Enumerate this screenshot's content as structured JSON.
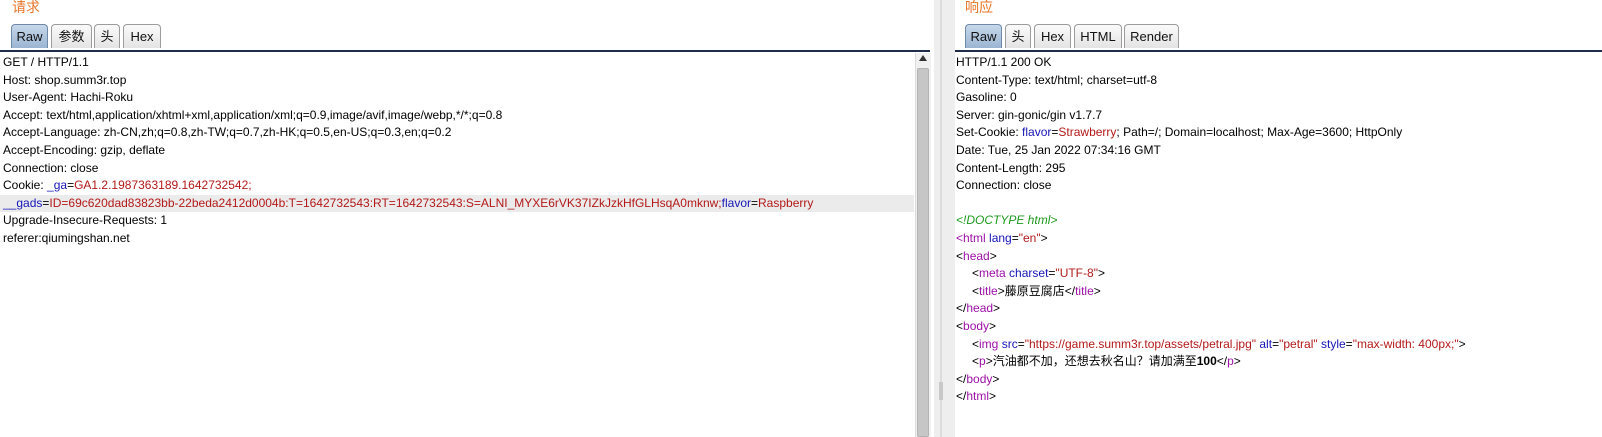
{
  "request": {
    "title": "请求",
    "tabs": [
      "Raw",
      "参数",
      "头",
      "Hex"
    ],
    "active_tab": "Raw",
    "lines": {
      "l1": "GET / HTTP/1.1",
      "l2": "Host: shop.summ3r.top",
      "l3": "User-Agent: Hachi-Roku",
      "l4": "Accept: text/html,application/xhtml+xml,application/xml;q=0.9,image/avif,image/webp,*/*;q=0.8",
      "l5": "Accept-Language: zh-CN,zh;q=0.8,zh-TW;q=0.7,zh-HK;q=0.5,en-US;q=0.3,en;q=0.2",
      "l6": "Accept-Encoding: gzip, deflate",
      "l7": "Connection: close",
      "cookie_prefix": "Cookie: ",
      "ga_key": "_ga",
      "ga_value": "GA1.2.1987363189.1642732542;",
      "gads_key": "__gads",
      "gads_value": "ID=69c620dad83823bb-22beda2412d0004b:T=1642732543:RT=1642732543:S=ALNI_MYXE6rVK37IZkJzkHfGLHsqA0mknw;",
      "flavor_key": "flavor",
      "flavor_value": "Raspberry",
      "l10": "Upgrade-Insecure-Requests: 1",
      "l11": "referer:qiumingshan.net"
    }
  },
  "response": {
    "title": "响应",
    "tabs": [
      "Raw",
      "头",
      "Hex",
      "HTML",
      "Render"
    ],
    "active_tab": "Raw",
    "headers": {
      "status": "HTTP/1.1 200 OK",
      "content_type": "Content-Type: text/html; charset=utf-8",
      "gasoline": "Gasoline: 0",
      "server": "Server: gin-gonic/gin v1.7.7",
      "setcookie_prefix": "Set-Cookie: ",
      "setcookie_key": "flavor",
      "setcookie_value": "Strawberry",
      "setcookie_rest": "; Path=/; Domain=localhost; Max-Age=3600; HttpOnly",
      "date": "Date: Tue, 25 Jan 2022 07:34:16 GMT",
      "content_length": "Content-Length: 295",
      "connection": "Connection: close"
    },
    "body": {
      "doctype": "<!DOCTYPE html>",
      "html_lang": "en",
      "meta_charset": "UTF-8",
      "title_text": "藤原豆腐店",
      "img_src": "https://game.summ3r.top/assets/petral.jpg",
      "img_alt": "petral",
      "img_style": "max-width: 400px;",
      "p_text": "汽油都不加，还想去秋名山？请加满至",
      "p_bold": "100"
    }
  }
}
